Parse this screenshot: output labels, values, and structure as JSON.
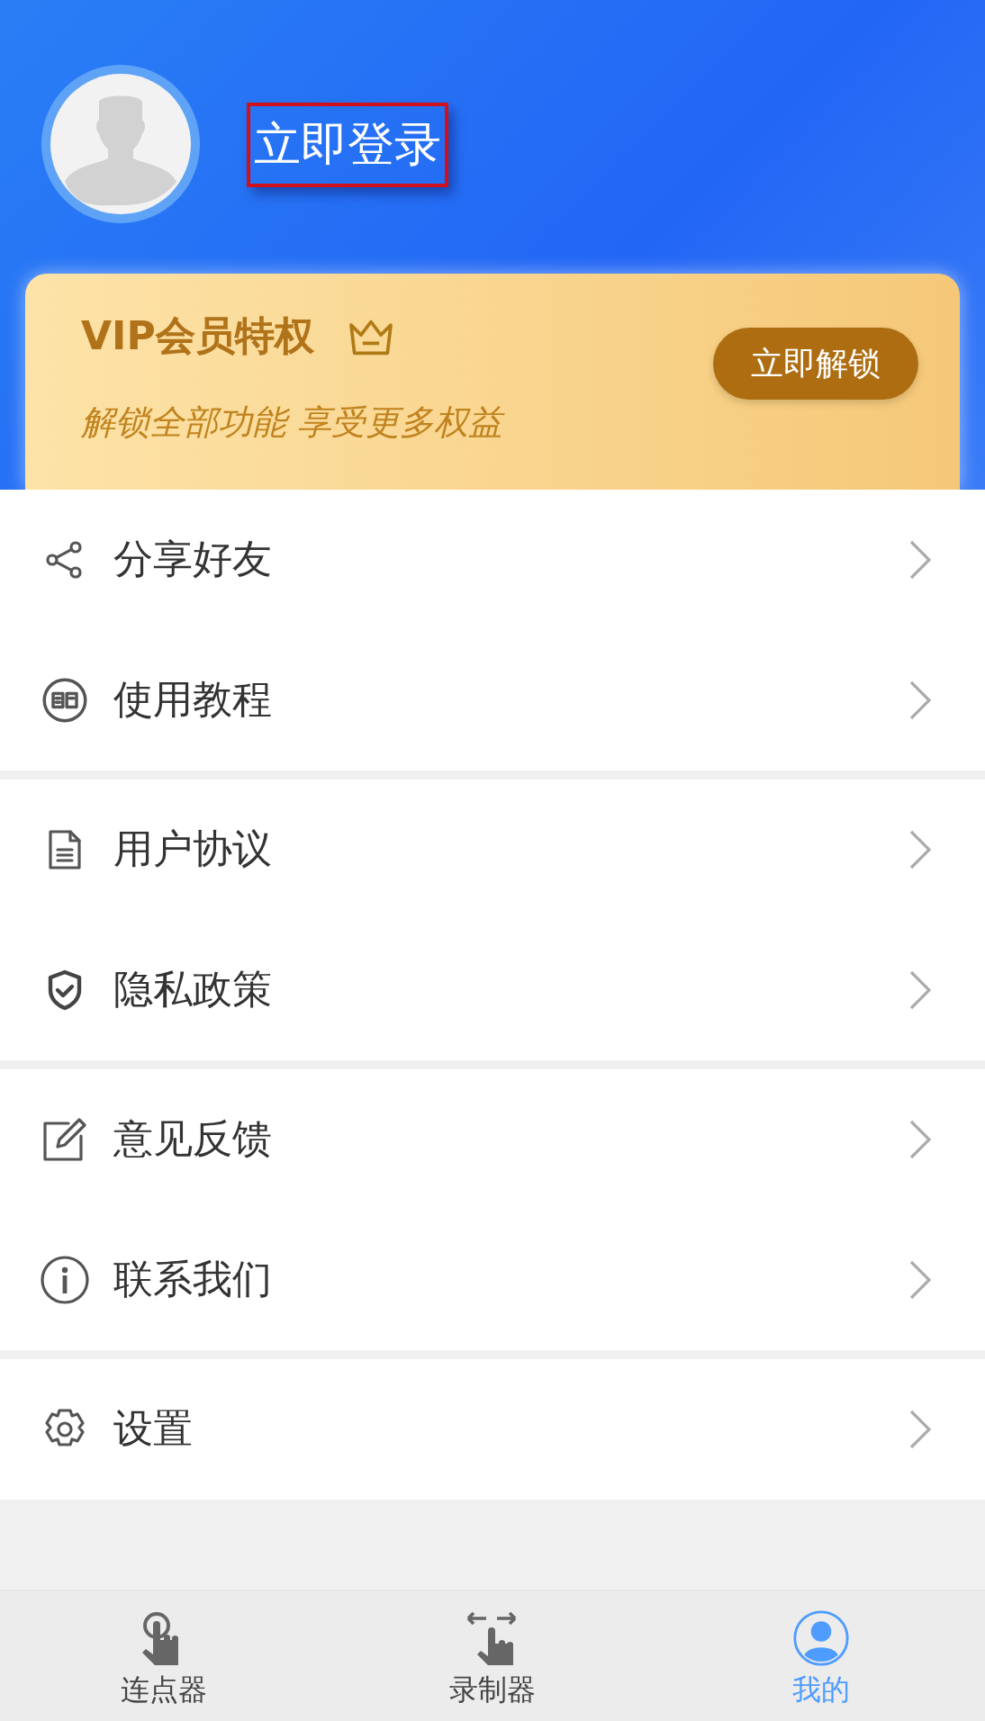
{
  "profile": {
    "login_label": "立即登录",
    "highlighted": true
  },
  "vip_card": {
    "title": "VIP会员特权",
    "subtitle": "解锁全部功能 享受更多权益",
    "button": "立即解锁"
  },
  "menu_groups": [
    {
      "items": [
        {
          "label": "分享好友",
          "kind": "share"
        },
        {
          "label": "使用教程",
          "kind": "book"
        }
      ]
    },
    {
      "items": [
        {
          "label": "用户协议",
          "kind": "document"
        },
        {
          "label": "隐私政策",
          "kind": "shield"
        }
      ]
    },
    {
      "items": [
        {
          "label": "意见反馈",
          "kind": "edit"
        },
        {
          "label": "联系我们",
          "kind": "info"
        }
      ]
    },
    {
      "items": [
        {
          "label": "设置",
          "kind": "gear"
        }
      ]
    }
  ],
  "tab_bar": [
    {
      "label": "连点器",
      "kind": "tap",
      "selected": false
    },
    {
      "label": "录制器",
      "kind": "swipe",
      "selected": false
    },
    {
      "label": "我的",
      "kind": "user",
      "selected": true
    }
  ]
}
